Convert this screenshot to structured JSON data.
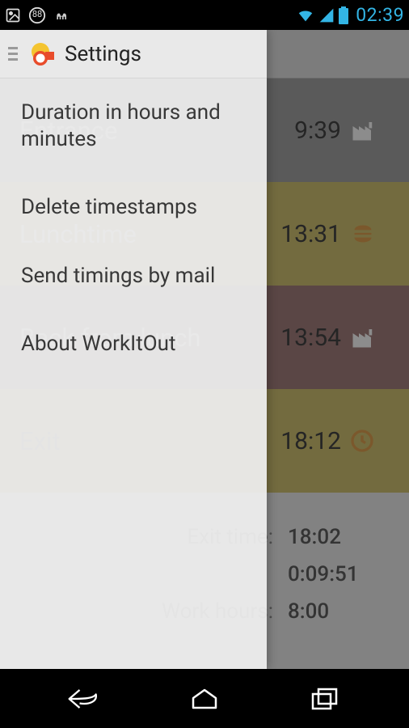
{
  "status_bar": {
    "battery_pct": "88",
    "time": "02:39"
  },
  "drawer": {
    "title": "Settings",
    "items": [
      "Duration in hours and minutes",
      "Delete timestamps",
      "Send timings by mail",
      "About WorkItOut"
    ]
  },
  "rows": {
    "entrance": {
      "label": "Entrance",
      "time": "9:39"
    },
    "lunchtime": {
      "label": "Lunchtime",
      "time": "13:31"
    },
    "backlunch": {
      "label": "Back from lunch",
      "time": "13:54"
    },
    "exit": {
      "label": "Exit",
      "time": "18:12"
    }
  },
  "summary": {
    "exit_time": {
      "label": "Exit time:",
      "value": "18:02"
    },
    "remaining": {
      "label": "",
      "value": "0:09:51"
    },
    "work_hours": {
      "label": "Work hours:",
      "value": "8:00"
    }
  }
}
